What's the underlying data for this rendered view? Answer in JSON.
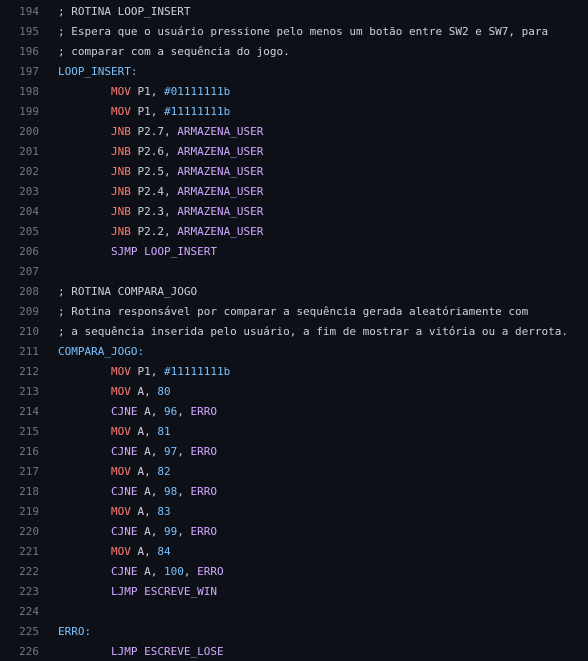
{
  "colors": {
    "background": "#0d1117",
    "line_number": "#6e7681",
    "text": "#c9d1d9",
    "label": "#79c0ff",
    "mnemonic_red": "#ff7b72",
    "mnemonic_purple": "#d2a8ff",
    "number": "#79c0ff"
  },
  "lines": [
    {
      "n": "194",
      "tokens": [
        {
          "t": "; ROTINA LOOP_INSERT",
          "c": "comment"
        }
      ]
    },
    {
      "n": "195",
      "tokens": [
        {
          "t": "; Espera que o usuário pressione pelo menos um botão entre SW2 e SW7, para",
          "c": "comment"
        }
      ]
    },
    {
      "n": "196",
      "tokens": [
        {
          "t": "; comparar com a sequência do jogo.",
          "c": "comment"
        }
      ]
    },
    {
      "n": "197",
      "tokens": [
        {
          "t": "LOOP_INSERT:",
          "c": "label"
        }
      ]
    },
    {
      "n": "198",
      "indent": true,
      "tokens": [
        {
          "t": "MOV",
          "c": "red"
        },
        {
          "t": " P1, ",
          "c": "plain"
        },
        {
          "t": "#01111111b",
          "c": "blue"
        }
      ]
    },
    {
      "n": "199",
      "indent": true,
      "tokens": [
        {
          "t": "MOV",
          "c": "red"
        },
        {
          "t": " P1, ",
          "c": "plain"
        },
        {
          "t": "#11111111b",
          "c": "blue"
        }
      ]
    },
    {
      "n": "200",
      "indent": true,
      "tokens": [
        {
          "t": "JNB",
          "c": "red"
        },
        {
          "t": " P2.7, ",
          "c": "plain"
        },
        {
          "t": "ARMAZENA_USER",
          "c": "purple"
        }
      ]
    },
    {
      "n": "201",
      "indent": true,
      "tokens": [
        {
          "t": "JNB",
          "c": "red"
        },
        {
          "t": " P2.6, ",
          "c": "plain"
        },
        {
          "t": "ARMAZENA_USER",
          "c": "purple"
        }
      ]
    },
    {
      "n": "202",
      "indent": true,
      "tokens": [
        {
          "t": "JNB",
          "c": "red"
        },
        {
          "t": " P2.5, ",
          "c": "plain"
        },
        {
          "t": "ARMAZENA_USER",
          "c": "purple"
        }
      ]
    },
    {
      "n": "203",
      "indent": true,
      "tokens": [
        {
          "t": "JNB",
          "c": "red"
        },
        {
          "t": " P2.4, ",
          "c": "plain"
        },
        {
          "t": "ARMAZENA_USER",
          "c": "purple"
        }
      ]
    },
    {
      "n": "204",
      "indent": true,
      "tokens": [
        {
          "t": "JNB",
          "c": "red"
        },
        {
          "t": " P2.3, ",
          "c": "plain"
        },
        {
          "t": "ARMAZENA_USER",
          "c": "purple"
        }
      ]
    },
    {
      "n": "205",
      "indent": true,
      "tokens": [
        {
          "t": "JNB",
          "c": "red"
        },
        {
          "t": " P2.2, ",
          "c": "plain"
        },
        {
          "t": "ARMAZENA_USER",
          "c": "purple"
        }
      ]
    },
    {
      "n": "206",
      "indent": true,
      "tokens": [
        {
          "t": "SJMP LOOP_INSERT",
          "c": "purple"
        }
      ]
    },
    {
      "n": "207",
      "tokens": []
    },
    {
      "n": "208",
      "tokens": [
        {
          "t": "; ROTINA COMPARA_JOGO",
          "c": "comment"
        }
      ]
    },
    {
      "n": "209",
      "tokens": [
        {
          "t": "; Rotina responsável por comparar a sequência gerada aleatóriamente com",
          "c": "comment"
        }
      ]
    },
    {
      "n": "210",
      "tokens": [
        {
          "t": "; a sequência inserida pelo usuário, a fim de mostrar a vitória ou a derrota.",
          "c": "comment"
        }
      ]
    },
    {
      "n": "211",
      "tokens": [
        {
          "t": "COMPARA_JOGO:",
          "c": "label"
        }
      ]
    },
    {
      "n": "212",
      "indent": true,
      "tokens": [
        {
          "t": "MOV",
          "c": "red"
        },
        {
          "t": " P1, ",
          "c": "plain"
        },
        {
          "t": "#11111111b",
          "c": "blue"
        }
      ]
    },
    {
      "n": "213",
      "indent": true,
      "tokens": [
        {
          "t": "MOV",
          "c": "red"
        },
        {
          "t": " A, ",
          "c": "plain"
        },
        {
          "t": "80",
          "c": "blue"
        }
      ]
    },
    {
      "n": "214",
      "indent": true,
      "tokens": [
        {
          "t": "CJNE",
          "c": "purple"
        },
        {
          "t": " A, ",
          "c": "plain"
        },
        {
          "t": "96",
          "c": "blue"
        },
        {
          "t": ", ",
          "c": "plain"
        },
        {
          "t": "ERRO",
          "c": "purple"
        }
      ]
    },
    {
      "n": "215",
      "indent": true,
      "tokens": [
        {
          "t": "MOV",
          "c": "red"
        },
        {
          "t": " A, ",
          "c": "plain"
        },
        {
          "t": "81",
          "c": "blue"
        }
      ]
    },
    {
      "n": "216",
      "indent": true,
      "tokens": [
        {
          "t": "CJNE",
          "c": "purple"
        },
        {
          "t": " A, ",
          "c": "plain"
        },
        {
          "t": "97",
          "c": "blue"
        },
        {
          "t": ", ",
          "c": "plain"
        },
        {
          "t": "ERRO",
          "c": "purple"
        }
      ]
    },
    {
      "n": "217",
      "indent": true,
      "tokens": [
        {
          "t": "MOV",
          "c": "red"
        },
        {
          "t": " A, ",
          "c": "plain"
        },
        {
          "t": "82",
          "c": "blue"
        }
      ]
    },
    {
      "n": "218",
      "indent": true,
      "tokens": [
        {
          "t": "CJNE",
          "c": "purple"
        },
        {
          "t": " A, ",
          "c": "plain"
        },
        {
          "t": "98",
          "c": "blue"
        },
        {
          "t": ", ",
          "c": "plain"
        },
        {
          "t": "ERRO",
          "c": "purple"
        }
      ]
    },
    {
      "n": "219",
      "indent": true,
      "tokens": [
        {
          "t": "MOV",
          "c": "red"
        },
        {
          "t": " A, ",
          "c": "plain"
        },
        {
          "t": "83",
          "c": "blue"
        }
      ]
    },
    {
      "n": "220",
      "indent": true,
      "tokens": [
        {
          "t": "CJNE",
          "c": "purple"
        },
        {
          "t": " A, ",
          "c": "plain"
        },
        {
          "t": "99",
          "c": "blue"
        },
        {
          "t": ", ",
          "c": "plain"
        },
        {
          "t": "ERRO",
          "c": "purple"
        }
      ]
    },
    {
      "n": "221",
      "indent": true,
      "tokens": [
        {
          "t": "MOV",
          "c": "red"
        },
        {
          "t": " A, ",
          "c": "plain"
        },
        {
          "t": "84",
          "c": "blue"
        }
      ]
    },
    {
      "n": "222",
      "indent": true,
      "tokens": [
        {
          "t": "CJNE",
          "c": "purple"
        },
        {
          "t": " A, ",
          "c": "plain"
        },
        {
          "t": "100",
          "c": "blue"
        },
        {
          "t": ", ",
          "c": "plain"
        },
        {
          "t": "ERRO",
          "c": "purple"
        }
      ]
    },
    {
      "n": "223",
      "indent": true,
      "tokens": [
        {
          "t": "LJMP ESCREVE_WIN",
          "c": "purple"
        }
      ]
    },
    {
      "n": "224",
      "tokens": []
    },
    {
      "n": "225",
      "tokens": [
        {
          "t": "ERRO:",
          "c": "label"
        }
      ]
    },
    {
      "n": "226",
      "indent": true,
      "tokens": [
        {
          "t": "LJMP ESCREVE_LOSE",
          "c": "purple"
        }
      ]
    }
  ]
}
